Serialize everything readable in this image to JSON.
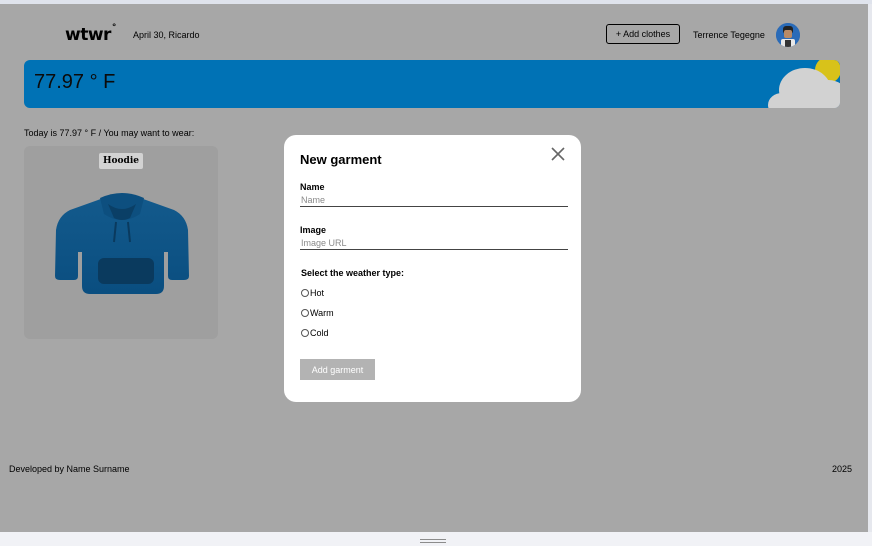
{
  "header": {
    "logo": "wtwr",
    "logo_mark": "°",
    "date_location": "April 30, Ricardo",
    "add_clothes_label": "+ Add clothes",
    "username": "Terrence Tegegne"
  },
  "weather": {
    "temperature": "77.97 ° F",
    "condition_icon": "cloud-sun-icon"
  },
  "main": {
    "today_text": "Today is 77.97 ° F / You may want to wear:",
    "cards": [
      {
        "name": "Hoodie",
        "icon": "hoodie-icon"
      }
    ]
  },
  "footer": {
    "credit": "Developed by Name Surname",
    "year": "2025"
  },
  "modal": {
    "title": "New garment",
    "close_icon": "close-icon",
    "name_label": "Name",
    "name_placeholder": "Name",
    "image_label": "Image",
    "image_placeholder": "Image URL",
    "weather_type_label": "Select the weather type:",
    "options": [
      "Hot",
      "Warm",
      "Cold"
    ],
    "submit_label": "Add garment"
  },
  "colors": {
    "overlay_background": "#a7a7a7",
    "weather_banner": "#0072b5",
    "modal_background": "#ffffff",
    "submit_disabled": "#b3b3b3"
  }
}
